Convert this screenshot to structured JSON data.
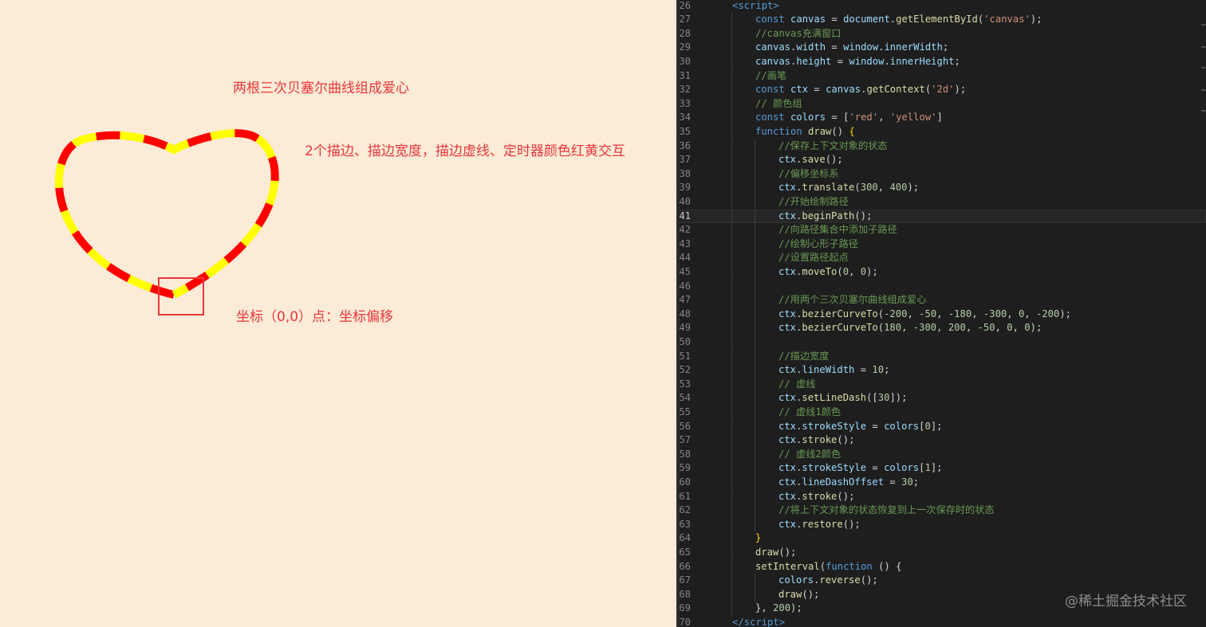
{
  "canvas": {
    "title_annotation": "两根三次贝塞尔曲线组成爱心",
    "desc_annotation": "2个描边、描边宽度，描边虚线、定时器颜色红黄交互",
    "origin_annotation": "坐标（0,0）点：坐标偏移",
    "heart": {
      "stroke_colors": [
        "#ff0000",
        "#ffff00"
      ],
      "line_width": 10,
      "dash": 30
    }
  },
  "editor": {
    "current_line": 41,
    "lines": [
      {
        "n": "26",
        "indent": 1,
        "tokens": [
          [
            "tag",
            "<"
          ],
          [
            "tagname",
            "script"
          ],
          [
            "tag",
            ">"
          ]
        ]
      },
      {
        "n": "27",
        "indent": 2,
        "tokens": [
          [
            "kw",
            "const "
          ],
          [
            "var",
            "canvas"
          ],
          [
            "pl",
            " = "
          ],
          [
            "var",
            "document"
          ],
          [
            "pl",
            "."
          ],
          [
            "fn",
            "getElementById"
          ],
          [
            "pl",
            "("
          ],
          [
            "str",
            "'canvas'"
          ],
          [
            "pl",
            ");"
          ]
        ]
      },
      {
        "n": "28",
        "indent": 2,
        "tokens": [
          [
            "com",
            "//canvas充满窗口"
          ]
        ]
      },
      {
        "n": "29",
        "indent": 2,
        "tokens": [
          [
            "var",
            "canvas"
          ],
          [
            "pl",
            "."
          ],
          [
            "var",
            "width"
          ],
          [
            "pl",
            " = "
          ],
          [
            "var",
            "window"
          ],
          [
            "pl",
            "."
          ],
          [
            "var",
            "innerWidth"
          ],
          [
            "pl",
            ";"
          ]
        ]
      },
      {
        "n": "30",
        "indent": 2,
        "tokens": [
          [
            "var",
            "canvas"
          ],
          [
            "pl",
            "."
          ],
          [
            "var",
            "height"
          ],
          [
            "pl",
            " = "
          ],
          [
            "var",
            "window"
          ],
          [
            "pl",
            "."
          ],
          [
            "var",
            "innerHeight"
          ],
          [
            "pl",
            ";"
          ]
        ]
      },
      {
        "n": "31",
        "indent": 2,
        "tokens": [
          [
            "com",
            "//画笔"
          ]
        ]
      },
      {
        "n": "32",
        "indent": 2,
        "tokens": [
          [
            "kw",
            "const "
          ],
          [
            "var",
            "ctx"
          ],
          [
            "pl",
            " = "
          ],
          [
            "var",
            "canvas"
          ],
          [
            "pl",
            "."
          ],
          [
            "fn",
            "getContext"
          ],
          [
            "pl",
            "("
          ],
          [
            "str",
            "'2d'"
          ],
          [
            "pl",
            ");"
          ]
        ]
      },
      {
        "n": "33",
        "indent": 2,
        "tokens": [
          [
            "com",
            "// 颜色组"
          ]
        ]
      },
      {
        "n": "34",
        "indent": 2,
        "tokens": [
          [
            "kw",
            "const "
          ],
          [
            "var",
            "colors"
          ],
          [
            "pl",
            " = ["
          ],
          [
            "str",
            "'red'"
          ],
          [
            "pl",
            ", "
          ],
          [
            "str",
            "'yellow'"
          ],
          [
            "pl",
            "]"
          ]
        ]
      },
      {
        "n": "35",
        "indent": 2,
        "tokens": [
          [
            "kw",
            "function "
          ],
          [
            "fn",
            "draw"
          ],
          [
            "pl",
            "() "
          ],
          [
            "bracket",
            "{"
          ]
        ]
      },
      {
        "n": "36",
        "indent": 3,
        "tokens": [
          [
            "com",
            "//保存上下文对象的状态"
          ]
        ]
      },
      {
        "n": "37",
        "indent": 3,
        "tokens": [
          [
            "var",
            "ctx"
          ],
          [
            "pl",
            "."
          ],
          [
            "fn",
            "save"
          ],
          [
            "pl",
            "();"
          ]
        ]
      },
      {
        "n": "38",
        "indent": 3,
        "tokens": [
          [
            "com",
            "//偏移坐标系"
          ]
        ]
      },
      {
        "n": "39",
        "indent": 3,
        "tokens": [
          [
            "var",
            "ctx"
          ],
          [
            "pl",
            "."
          ],
          [
            "fn",
            "translate"
          ],
          [
            "pl",
            "("
          ],
          [
            "num",
            "300"
          ],
          [
            "pl",
            ", "
          ],
          [
            "num",
            "400"
          ],
          [
            "pl",
            ");"
          ]
        ]
      },
      {
        "n": "40",
        "indent": 3,
        "tokens": [
          [
            "com",
            "//开始绘制路径"
          ]
        ]
      },
      {
        "n": "41",
        "indent": 3,
        "tokens": [
          [
            "var",
            "ctx"
          ],
          [
            "pl",
            "."
          ],
          [
            "fn",
            "beginPath"
          ],
          [
            "pl",
            "();"
          ]
        ]
      },
      {
        "n": "42",
        "indent": 3,
        "tokens": [
          [
            "com",
            "//向路径集合中添加子路径"
          ]
        ]
      },
      {
        "n": "43",
        "indent": 3,
        "tokens": [
          [
            "com",
            "//绘制心形子路径"
          ]
        ]
      },
      {
        "n": "44",
        "indent": 3,
        "tokens": [
          [
            "com",
            "//设置路径起点"
          ]
        ]
      },
      {
        "n": "45",
        "indent": 3,
        "tokens": [
          [
            "var",
            "ctx"
          ],
          [
            "pl",
            "."
          ],
          [
            "fn",
            "moveTo"
          ],
          [
            "pl",
            "("
          ],
          [
            "num",
            "0"
          ],
          [
            "pl",
            ", "
          ],
          [
            "num",
            "0"
          ],
          [
            "pl",
            ");"
          ]
        ]
      },
      {
        "n": "46",
        "indent": 3,
        "tokens": []
      },
      {
        "n": "47",
        "indent": 3,
        "tokens": [
          [
            "com",
            "//用两个三次贝塞尔曲线组成爱心"
          ]
        ]
      },
      {
        "n": "48",
        "indent": 3,
        "tokens": [
          [
            "var",
            "ctx"
          ],
          [
            "pl",
            "."
          ],
          [
            "fn",
            "bezierCurveTo"
          ],
          [
            "pl",
            "("
          ],
          [
            "num",
            "-200"
          ],
          [
            "pl",
            ", "
          ],
          [
            "num",
            "-50"
          ],
          [
            "pl",
            ", "
          ],
          [
            "num",
            "-180"
          ],
          [
            "pl",
            ", "
          ],
          [
            "num",
            "-300"
          ],
          [
            "pl",
            ", "
          ],
          [
            "num",
            "0"
          ],
          [
            "pl",
            ", "
          ],
          [
            "num",
            "-200"
          ],
          [
            "pl",
            ");"
          ]
        ]
      },
      {
        "n": "49",
        "indent": 3,
        "tokens": [
          [
            "var",
            "ctx"
          ],
          [
            "pl",
            "."
          ],
          [
            "fn",
            "bezierCurveTo"
          ],
          [
            "pl",
            "("
          ],
          [
            "num",
            "180"
          ],
          [
            "pl",
            ", "
          ],
          [
            "num",
            "-300"
          ],
          [
            "pl",
            ", "
          ],
          [
            "num",
            "200"
          ],
          [
            "pl",
            ", "
          ],
          [
            "num",
            "-50"
          ],
          [
            "pl",
            ", "
          ],
          [
            "num",
            "0"
          ],
          [
            "pl",
            ", "
          ],
          [
            "num",
            "0"
          ],
          [
            "pl",
            ");"
          ]
        ]
      },
      {
        "n": "50",
        "indent": 3,
        "tokens": []
      },
      {
        "n": "51",
        "indent": 3,
        "tokens": [
          [
            "com",
            "//描边宽度"
          ]
        ]
      },
      {
        "n": "52",
        "indent": 3,
        "tokens": [
          [
            "var",
            "ctx"
          ],
          [
            "pl",
            "."
          ],
          [
            "var",
            "lineWidth"
          ],
          [
            "pl",
            " = "
          ],
          [
            "num",
            "10"
          ],
          [
            "pl",
            ";"
          ]
        ]
      },
      {
        "n": "53",
        "indent": 3,
        "tokens": [
          [
            "com",
            "// 虚线"
          ]
        ]
      },
      {
        "n": "54",
        "indent": 3,
        "tokens": [
          [
            "var",
            "ctx"
          ],
          [
            "pl",
            "."
          ],
          [
            "fn",
            "setLineDash"
          ],
          [
            "pl",
            "(["
          ],
          [
            "num",
            "30"
          ],
          [
            "pl",
            "]);"
          ]
        ]
      },
      {
        "n": "55",
        "indent": 3,
        "tokens": [
          [
            "com",
            "// 虚线1颜色"
          ]
        ]
      },
      {
        "n": "56",
        "indent": 3,
        "tokens": [
          [
            "var",
            "ctx"
          ],
          [
            "pl",
            "."
          ],
          [
            "var",
            "strokeStyle"
          ],
          [
            "pl",
            " = "
          ],
          [
            "var",
            "colors"
          ],
          [
            "pl",
            "["
          ],
          [
            "num",
            "0"
          ],
          [
            "pl",
            "];"
          ]
        ]
      },
      {
        "n": "57",
        "indent": 3,
        "tokens": [
          [
            "var",
            "ctx"
          ],
          [
            "pl",
            "."
          ],
          [
            "fn",
            "stroke"
          ],
          [
            "pl",
            "();"
          ]
        ]
      },
      {
        "n": "58",
        "indent": 3,
        "tokens": [
          [
            "com",
            "// 虚线2颜色"
          ]
        ]
      },
      {
        "n": "59",
        "indent": 3,
        "tokens": [
          [
            "var",
            "ctx"
          ],
          [
            "pl",
            "."
          ],
          [
            "var",
            "strokeStyle"
          ],
          [
            "pl",
            " = "
          ],
          [
            "var",
            "colors"
          ],
          [
            "pl",
            "["
          ],
          [
            "num",
            "1"
          ],
          [
            "pl",
            "];"
          ]
        ]
      },
      {
        "n": "60",
        "indent": 3,
        "tokens": [
          [
            "var",
            "ctx"
          ],
          [
            "pl",
            "."
          ],
          [
            "var",
            "lineDashOffset"
          ],
          [
            "pl",
            " = "
          ],
          [
            "num",
            "30"
          ],
          [
            "pl",
            ";"
          ]
        ]
      },
      {
        "n": "61",
        "indent": 3,
        "tokens": [
          [
            "var",
            "ctx"
          ],
          [
            "pl",
            "."
          ],
          [
            "fn",
            "stroke"
          ],
          [
            "pl",
            "();"
          ]
        ]
      },
      {
        "n": "62",
        "indent": 3,
        "tokens": [
          [
            "com",
            "//将上下文对象的状态恢复到上一次保存时的状态"
          ]
        ]
      },
      {
        "n": "63",
        "indent": 3,
        "tokens": [
          [
            "var",
            "ctx"
          ],
          [
            "pl",
            "."
          ],
          [
            "fn",
            "restore"
          ],
          [
            "pl",
            "();"
          ]
        ]
      },
      {
        "n": "64",
        "indent": 2,
        "tokens": [
          [
            "bracket",
            "}"
          ]
        ]
      },
      {
        "n": "65",
        "indent": 2,
        "tokens": [
          [
            "fn",
            "draw"
          ],
          [
            "pl",
            "();"
          ]
        ]
      },
      {
        "n": "66",
        "indent": 2,
        "tokens": [
          [
            "fn",
            "setInterval"
          ],
          [
            "pl",
            "("
          ],
          [
            "kw",
            "function"
          ],
          [
            "pl",
            " () {"
          ]
        ]
      },
      {
        "n": "67",
        "indent": 3,
        "tokens": [
          [
            "var",
            "colors"
          ],
          [
            "pl",
            "."
          ],
          [
            "fn",
            "reverse"
          ],
          [
            "pl",
            "();"
          ]
        ]
      },
      {
        "n": "68",
        "indent": 3,
        "tokens": [
          [
            "fn",
            "draw"
          ],
          [
            "pl",
            "();"
          ]
        ]
      },
      {
        "n": "69",
        "indent": 2,
        "tokens": [
          [
            "pl",
            "}, "
          ],
          [
            "num",
            "200"
          ],
          [
            "pl",
            ");"
          ]
        ]
      },
      {
        "n": "70",
        "indent": 1,
        "tokens": [
          [
            "tag",
            "</"
          ],
          [
            "tagname",
            "script"
          ],
          [
            "tag",
            ">"
          ]
        ]
      }
    ]
  },
  "watermark": "@稀土掘金技术社区"
}
